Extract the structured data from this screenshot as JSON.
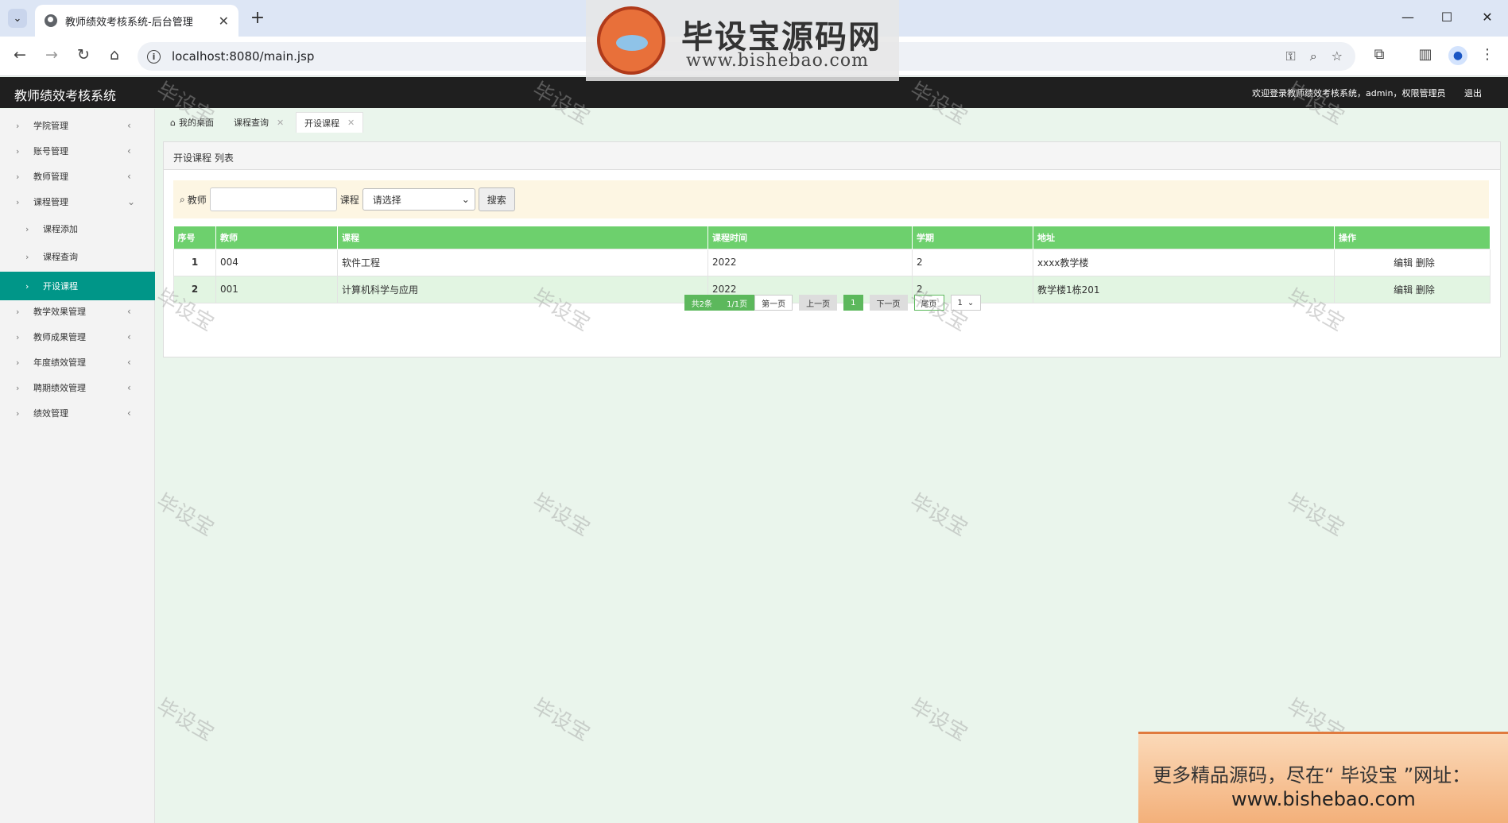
{
  "browser": {
    "tab_title": "教师绩效考核系统-后台管理",
    "url": "localhost:8080/main.jsp",
    "icons": [
      "tab-menu-icon",
      "globe-icon",
      "close-icon",
      "plus-icon",
      "minimize-icon",
      "maximize-icon",
      "close-window-icon",
      "back-icon",
      "forward-icon",
      "reload-icon",
      "home-icon",
      "info-icon",
      "key-icon",
      "zoom-icon",
      "star-icon",
      "extensions-icon",
      "sidepanel-icon",
      "profile-icon",
      "menu-icon"
    ]
  },
  "header": {
    "title": "教师绩效考核系统",
    "welcome": "欢迎登录教师绩效考核系统，admin，权限管理员",
    "logout": "退出"
  },
  "sidebar": {
    "items": [
      {
        "label": "学院管理"
      },
      {
        "label": "账号管理"
      },
      {
        "label": "教师管理"
      },
      {
        "label": "课程管理"
      },
      {
        "label": "课程添加"
      },
      {
        "label": "课程查询"
      },
      {
        "label": "开设课程"
      },
      {
        "label": "教学效果管理"
      },
      {
        "label": "教师成果管理"
      },
      {
        "label": "年度绩效管理"
      },
      {
        "label": "聘期绩效管理"
      },
      {
        "label": "绩效管理"
      }
    ]
  },
  "tabs": [
    {
      "label": "我的桌面"
    },
    {
      "label": "课程查询"
    },
    {
      "label": "开设课程"
    }
  ],
  "panel": {
    "title": "开设课程 列表",
    "search": {
      "teacher_label": "教师",
      "course_label": "课程",
      "course_select": "请选择",
      "button": "搜索"
    },
    "table": {
      "headers": [
        "序号",
        "教师",
        "课程",
        "课程时间",
        "学期",
        "地址",
        "操作"
      ],
      "rows": [
        {
          "idx": "1",
          "teacher": "004",
          "course": "软件工程",
          "time": "2022",
          "term": "2",
          "addr": "xxxx教学楼",
          "edit": "编辑",
          "del": "删除"
        },
        {
          "idx": "2",
          "teacher": "001",
          "course": "计算机科学与应用",
          "time": "2022",
          "term": "2",
          "addr": "教学楼1栋201",
          "edit": "编辑",
          "del": "删除"
        }
      ]
    },
    "pager": {
      "total": "共2条",
      "pages": "1/1页",
      "first": "第一页",
      "prev": "上一页",
      "current": "1",
      "next": "下一页",
      "last": "尾页",
      "jump": "1"
    }
  },
  "watermark": {
    "logo_title": "毕设宝源码网",
    "logo_url": "www.bishebao.com",
    "stamp": "毕设宝",
    "promo_line1": "更多精品源码，尽在“ 毕设宝 ”网址：",
    "promo_line2": "www.bishebao.com"
  }
}
